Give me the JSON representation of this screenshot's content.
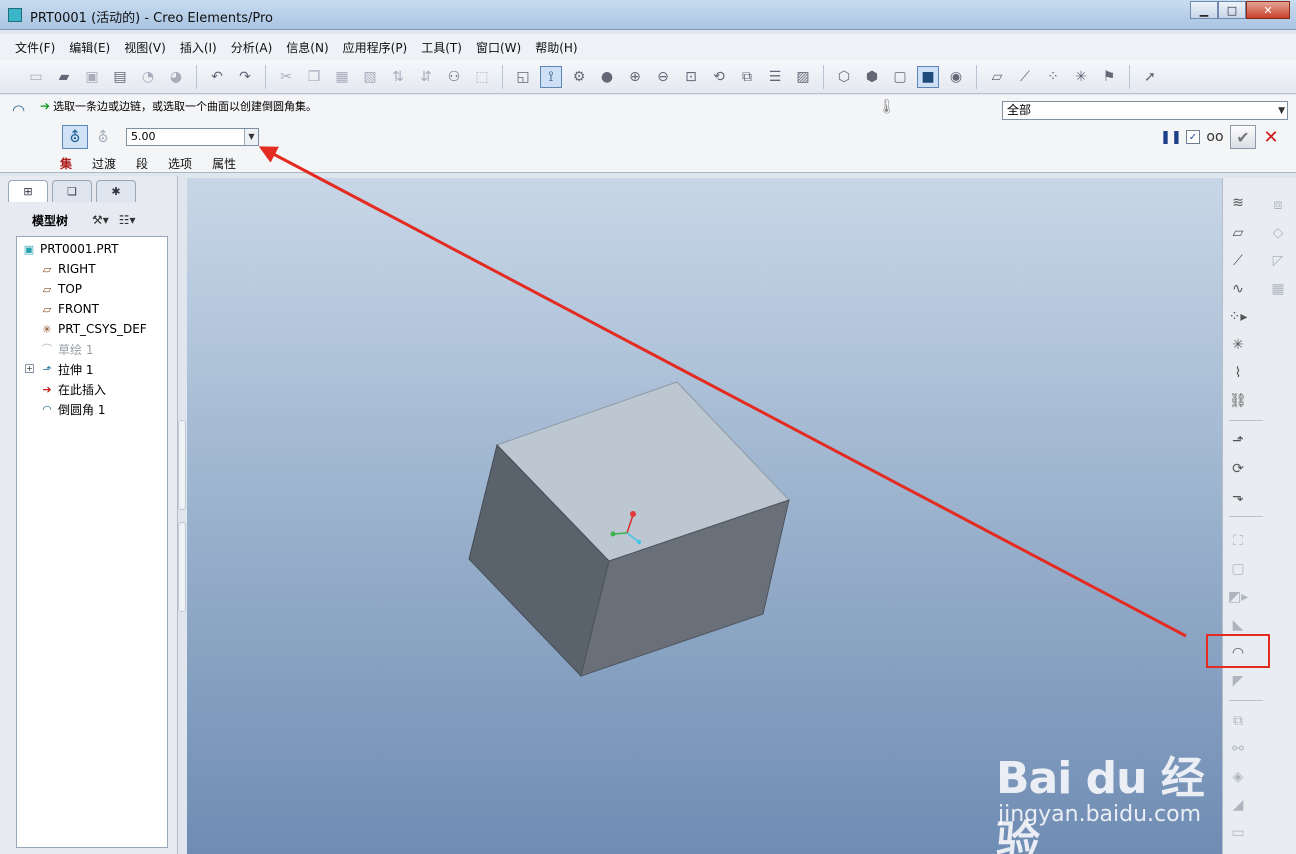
{
  "window": {
    "title": "PRT0001 (活动的) - Creo Elements/Pro",
    "min_label": "▁",
    "max_label": "□",
    "close_label": "✕"
  },
  "menu": [
    "文件(F)",
    "编辑(E)",
    "视图(V)",
    "插入(I)",
    "分析(A)",
    "信息(N)",
    "应用程序(P)",
    "工具(T)",
    "窗口(W)",
    "帮助(H)"
  ],
  "dashboard": {
    "prompt": "选取一条边或边链，或选取一个曲面以创建倒圆角集。",
    "filter_value": "全部",
    "radius_value": "5.00",
    "tabs": [
      "集",
      "过渡",
      "段",
      "选项",
      "属性"
    ],
    "active_tab": "集"
  },
  "navigator": {
    "title": "模型树",
    "tree": [
      {
        "label": "PRT0001.PRT",
        "icon": "part-icon",
        "level": 0
      },
      {
        "label": "RIGHT",
        "icon": "datum-plane-icon",
        "level": 1
      },
      {
        "label": "TOP",
        "icon": "datum-plane-icon",
        "level": 1
      },
      {
        "label": "FRONT",
        "icon": "datum-plane-icon",
        "level": 1
      },
      {
        "label": "PRT_CSYS_DEF",
        "icon": "csys-icon",
        "level": 1
      },
      {
        "label": "草绘 1",
        "icon": "sketch-icon",
        "level": 1,
        "dim": true
      },
      {
        "label": "拉伸 1",
        "icon": "extrude-icon",
        "level": 1,
        "expander": "+"
      },
      {
        "label": "在此插入",
        "icon": "insert-here-icon",
        "level": 1
      },
      {
        "label": "倒圆角 1",
        "icon": "round-icon",
        "level": 1
      }
    ]
  },
  "watermark": {
    "brand": "Bai du 经验",
    "url": "jingyan.baidu.com"
  },
  "colors": {
    "accent_red": "#e42b22",
    "cube_top": "#bcc7d2",
    "cube_left": "#5a626c",
    "cube_right": "#697079"
  }
}
